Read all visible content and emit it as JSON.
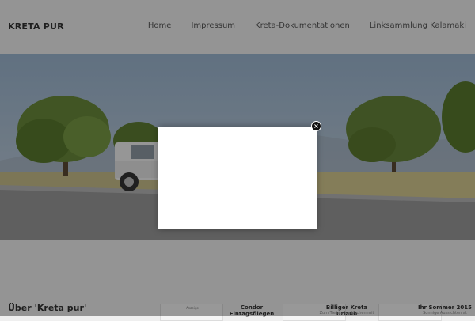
{
  "header": {
    "brand": "KRETA PUR"
  },
  "nav": {
    "items": [
      {
        "label": "Home"
      },
      {
        "label": "Impressum"
      },
      {
        "label": "Kreta-Dokumentationen"
      },
      {
        "label": "Linksammlung Kalamaki"
      }
    ]
  },
  "hero": {
    "image": "landscape-road-with-white-suv-and-trees"
  },
  "section": {
    "title": "Über 'Kreta pur'"
  },
  "ads": {
    "label": "Anzeige",
    "items": [
      {
        "title": "Condor Eintagsfliegen",
        "text": ""
      },
      {
        "title": "Billiger Kreta Urlaub",
        "text": "Zum Tiefstpreis buchen mit"
      },
      {
        "title": "Ihr Sommer 2015",
        "text": "Sonnige Aussichten at"
      }
    ]
  },
  "modal": {
    "close_icon": "close-icon"
  }
}
